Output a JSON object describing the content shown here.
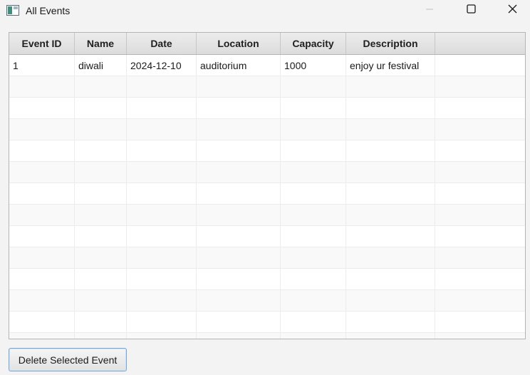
{
  "window": {
    "title": "All Events"
  },
  "table": {
    "columns": [
      "Event ID",
      "Name",
      "Date",
      "Location",
      "Capacity",
      "Description",
      ""
    ],
    "rows": [
      [
        "1",
        "diwali",
        "2024-12-10",
        "auditorium",
        "1000",
        "enjoy ur festival",
        ""
      ],
      [
        "",
        "",
        "",
        "",
        "",
        "",
        ""
      ],
      [
        "",
        "",
        "",
        "",
        "",
        "",
        ""
      ],
      [
        "",
        "",
        "",
        "",
        "",
        "",
        ""
      ],
      [
        "",
        "",
        "",
        "",
        "",
        "",
        ""
      ],
      [
        "",
        "",
        "",
        "",
        "",
        "",
        ""
      ],
      [
        "",
        "",
        "",
        "",
        "",
        "",
        ""
      ],
      [
        "",
        "",
        "",
        "",
        "",
        "",
        ""
      ],
      [
        "",
        "",
        "",
        "",
        "",
        "",
        ""
      ],
      [
        "",
        "",
        "",
        "",
        "",
        "",
        ""
      ],
      [
        "",
        "",
        "",
        "",
        "",
        "",
        ""
      ],
      [
        "",
        "",
        "",
        "",
        "",
        "",
        ""
      ],
      [
        "",
        "",
        "",
        "",
        "",
        "",
        ""
      ],
      [
        "",
        "",
        "",
        "",
        "",
        "",
        ""
      ]
    ]
  },
  "actions": {
    "delete_label": "Delete Selected Event"
  },
  "icons": {
    "app": "app-window-icon",
    "minimize": "minimize-icon",
    "maximize": "maximize-icon",
    "close": "close-icon"
  },
  "colors": {
    "button_border": "#7aa7d6",
    "header_bg": "#dcdcdc",
    "window_bg": "#f3f3f3"
  }
}
